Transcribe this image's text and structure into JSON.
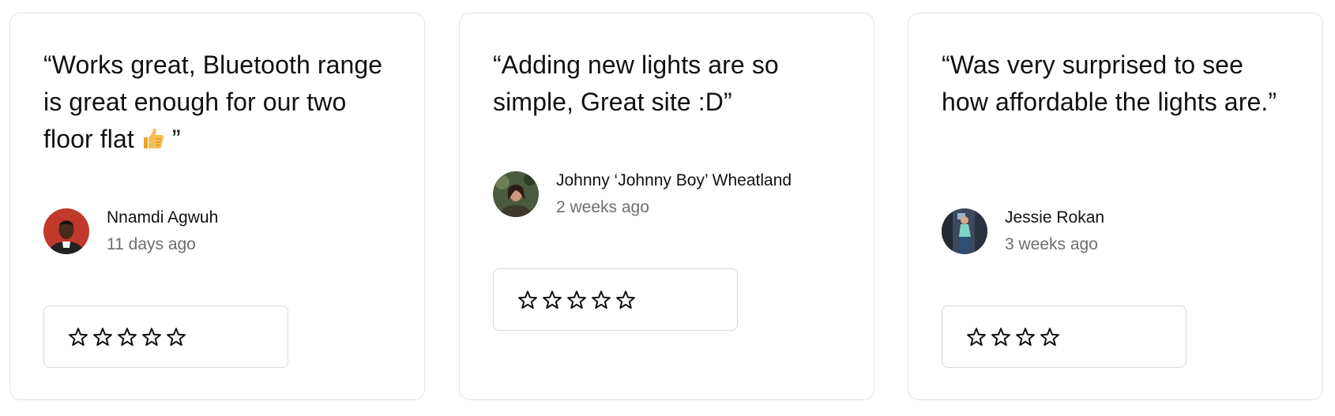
{
  "reviews": [
    {
      "quote": "“Works great, Bluetooth range is great enough for our two floor flat",
      "quote_end": " ”",
      "emoji": "thumbs-up-icon",
      "author": "Nnamdi Agwuh",
      "time": "11 days ago",
      "rating": 5,
      "avatar_bg": "#c0392b"
    },
    {
      "quote": "“Adding new lights are so simple, Great site :D”",
      "author": "Johnny ‘Johnny Boy’ Wheatland",
      "time": "2 weeks ago",
      "rating": 5,
      "avatar_bg": "#4a5a3c"
    },
    {
      "quote": "“Was very surprised to see how affordable the lights are.”",
      "author": "Jessie Rokan",
      "time": "3 weeks ago",
      "rating": 4,
      "avatar_bg": "#3b4a5e"
    }
  ],
  "colors": {
    "card_border": "#e4e4e4",
    "text": "#111111",
    "muted": "#6e6e6e",
    "star_stroke": "#111111",
    "emoji": "#f2b33d"
  }
}
